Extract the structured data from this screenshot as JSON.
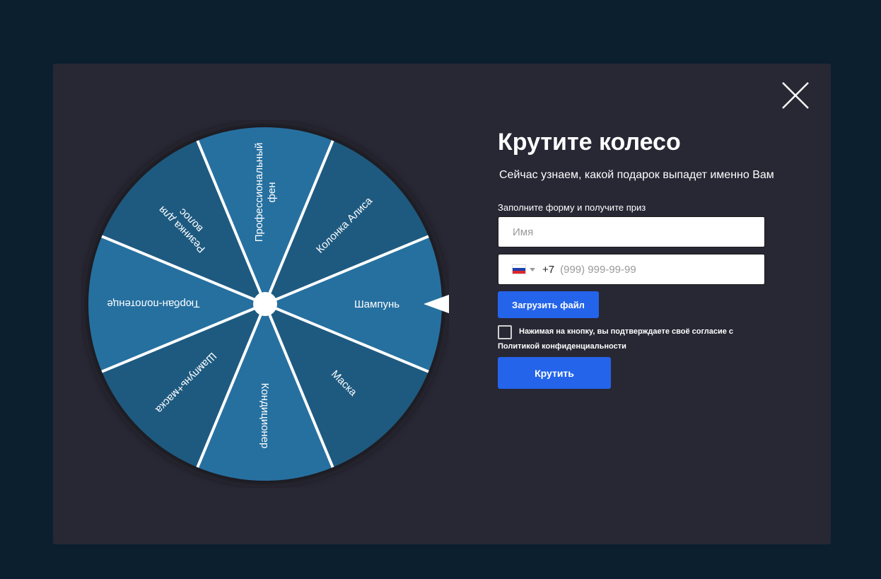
{
  "modal": {
    "title": "Крутите колесо",
    "subtitle": "Сейчас узнаем, какой подарок выпадет именно Вам",
    "close_icon": "close-icon"
  },
  "wheel": {
    "segments": [
      {
        "label": "Шампунь",
        "color": "#2670a0"
      },
      {
        "label": "Маска",
        "color": "#1e5a80"
      },
      {
        "label": "Кондиционер",
        "color": "#2670a0"
      },
      {
        "label": "Шампунь+маска",
        "color": "#1e5a80"
      },
      {
        "label": "Тюрбан-полотенце",
        "color": "#2670a0"
      },
      {
        "label": "Резинка для волос",
        "color": "#1e5a80"
      },
      {
        "label": "Профессиональный фен",
        "color": "#2670a0"
      },
      {
        "label": "Колонка Алиса",
        "color": "#1e5a80"
      }
    ],
    "pointer_icon": "triangle-pointer-icon"
  },
  "form": {
    "label": "Заполните форму и получите приз",
    "name_placeholder": "Имя",
    "phone_code": "+7",
    "phone_placeholder": "(999) 999-99-99",
    "flag_icon": "russia-flag-icon",
    "upload_label": "Загрузить файл",
    "consent_text": "Нажимая на кнопку, вы подтверждаете своё согласие с",
    "consent_link": "Политикой конфиденциальности",
    "submit_label": "Крутить"
  },
  "colors": {
    "page_bg": "#0b1f2e",
    "modal_bg": "#282734",
    "accent": "#2364ea",
    "segment_light": "#2670a0",
    "segment_dark": "#1e5a80"
  }
}
